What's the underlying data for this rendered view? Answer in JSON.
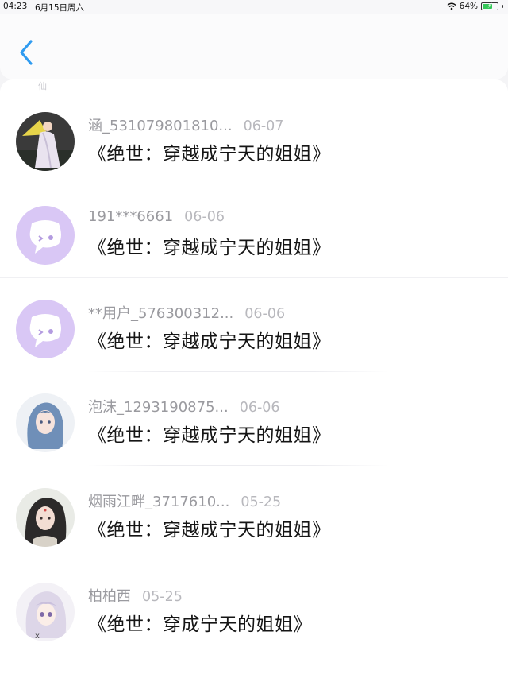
{
  "status_bar": {
    "time": "04:23",
    "date": "6月15日周六",
    "battery_text": "64%",
    "battery_level": 0.64
  },
  "header": {
    "back_icon": "chevron-left-icon",
    "accent_color": "#2f9bf0"
  },
  "list": {
    "top_mark": "仙",
    "items": [
      {
        "username": "涵_531079801810...",
        "date": "06-07",
        "title": "《绝世：穿越成宁天的姐姐》",
        "avatar": "photo-avatar"
      },
      {
        "username": "191***6661",
        "date": "06-06",
        "title": "《绝世：穿越成宁天的姐姐》",
        "avatar": "default-chat-avatar"
      },
      {
        "username": "**用户_576300312...",
        "date": "06-06",
        "title": "《绝世：穿越成宁天的姐姐》",
        "avatar": "default-chat-avatar"
      },
      {
        "username": "泡沫_1293190875...",
        "date": "06-06",
        "title": "《绝世：穿越成宁天的姐姐》",
        "avatar": "anime-avatar"
      },
      {
        "username": "烟雨江畔_3717610...",
        "date": "05-25",
        "title": "《绝世：穿越成宁天的姐姐》",
        "avatar": "anime-avatar"
      },
      {
        "username": "柏柏西",
        "date": "05-25",
        "title": "《绝世：穿成宁天的姐姐》",
        "avatar": "anime-avatar"
      }
    ]
  },
  "colors": {
    "default_avatar_bg": "#d9c7f5",
    "default_avatar_fg": "#ffffff"
  }
}
